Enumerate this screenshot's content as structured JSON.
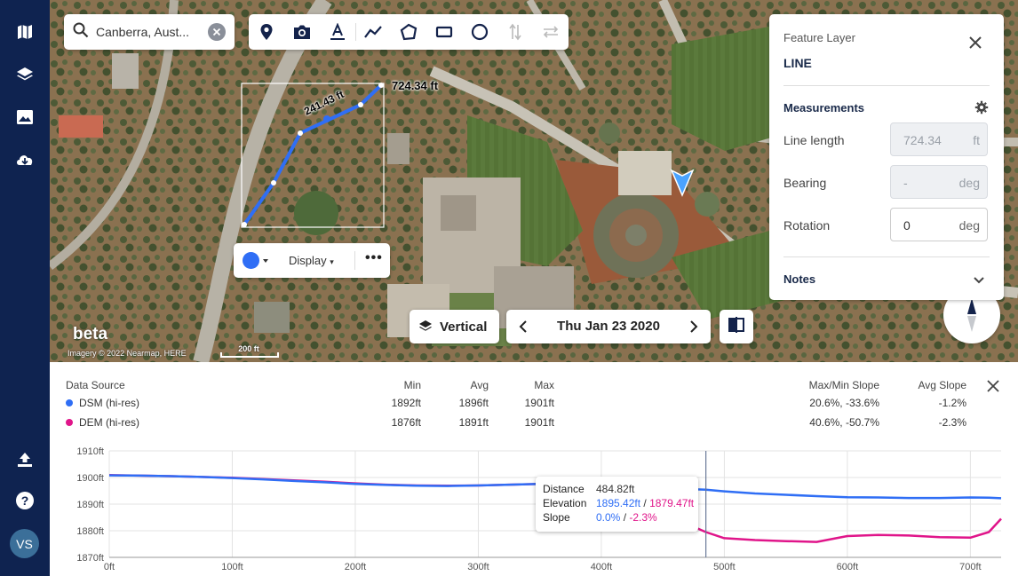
{
  "nav": {
    "items": [
      "map-icon",
      "layers-icon",
      "image-icon",
      "cloud-download-icon"
    ],
    "bottom": [
      "upload-icon",
      "help-icon"
    ],
    "avatar": "VS"
  },
  "search": {
    "value": "Canberra, Aust...",
    "placeholder": "Search"
  },
  "toolbar": {
    "tools": [
      "marker-icon",
      "camera-icon",
      "text-icon",
      "polyline-icon",
      "polygon-icon",
      "rectangle-icon",
      "circle-icon",
      "vertical-measure-icon",
      "swap-icon"
    ]
  },
  "map": {
    "segment_label": "241.43 ft",
    "total_label": "724.34 ft",
    "beta": "beta",
    "credit": "Imagery © 2022 Nearmap, HERE",
    "scale": "200 ft"
  },
  "style_bar": {
    "color": "#2f6ef5",
    "display_label": "Display",
    "more": "•••"
  },
  "view_mode": {
    "label": "Vertical"
  },
  "date_nav": {
    "date": "Thu Jan 23 2020"
  },
  "panel": {
    "subtitle": "Feature Layer",
    "title": "LINE",
    "measurements_title": "Measurements",
    "fields": [
      {
        "label": "Line length",
        "value": "724.34",
        "unit": "ft",
        "disabled": true
      },
      {
        "label": "Bearing",
        "value": "-",
        "unit": "deg",
        "disabled": true
      },
      {
        "label": "Rotation",
        "value": "0",
        "unit": "deg",
        "disabled": false
      }
    ],
    "notes_title": "Notes"
  },
  "profile": {
    "headers": {
      "source": "Data Source",
      "min": "Min",
      "avg": "Avg",
      "max": "Max",
      "slope": "Max/Min Slope",
      "avg_slope": "Avg Slope"
    },
    "rows": [
      {
        "name": "DSM (hi-res)",
        "color": "#2f6ef5",
        "min": "1892ft",
        "avg": "1896ft",
        "max": "1901ft",
        "slope": "20.6%, -33.6%",
        "avg_slope": "-1.2%"
      },
      {
        "name": "DEM (hi-res)",
        "color": "#e0158a",
        "min": "1876ft",
        "avg": "1891ft",
        "max": "1901ft",
        "slope": "40.6%, -50.7%",
        "avg_slope": "-2.3%"
      }
    ],
    "tooltip": {
      "distance_label": "Distance",
      "distance": "484.82ft",
      "elevation_label": "Elevation",
      "elev_dsm": "1895.42ft",
      "elev_sep": " / ",
      "elev_dem": "1879.47ft",
      "slope_label": "Slope",
      "slope_dsm": "0.0%",
      "slope_sep": " / ",
      "slope_dem": "-2.3%"
    }
  },
  "chart_data": {
    "type": "line",
    "x": [
      0,
      25,
      50,
      75,
      100,
      125,
      150,
      175,
      200,
      225,
      250,
      275,
      300,
      325,
      350,
      375,
      400,
      425,
      450,
      475,
      485,
      500,
      525,
      550,
      575,
      600,
      625,
      650,
      675,
      700,
      715,
      725
    ],
    "series": [
      {
        "name": "DSM (hi-res)",
        "color": "#2f6ef5",
        "values": [
          1900.8,
          1900.7,
          1900.5,
          1900.2,
          1899.8,
          1899.3,
          1898.7,
          1898.2,
          1897.6,
          1897.2,
          1896.9,
          1896.8,
          1897.0,
          1897.3,
          1897.6,
          1897.2,
          1896.7,
          1896.1,
          1895.8,
          1895.6,
          1895.4,
          1894.8,
          1894.0,
          1893.5,
          1893.0,
          1892.6,
          1892.5,
          1892.3,
          1892.3,
          1892.5,
          1892.4,
          1892.2
        ]
      },
      {
        "name": "DEM (hi-res)",
        "color": "#e0158a",
        "values": [
          1900.9,
          1900.7,
          1900.5,
          1900.2,
          1899.9,
          1899.4,
          1898.9,
          1898.4,
          1897.8,
          1897.3,
          1897.0,
          1896.9,
          1897.0,
          1897.3,
          1897.6,
          1896.4,
          1893.0,
          1889.0,
          1885.0,
          1881.5,
          1879.5,
          1877.2,
          1876.5,
          1876.1,
          1875.8,
          1878.0,
          1878.4,
          1878.2,
          1877.6,
          1877.4,
          1879.5,
          1884.5
        ]
      }
    ],
    "xlim": [
      0,
      725
    ],
    "ylim": [
      1870,
      1910
    ],
    "x_ticks": [
      "0ft",
      "100ft",
      "200ft",
      "300ft",
      "400ft",
      "500ft",
      "600ft",
      "700ft"
    ],
    "x_tick_values": [
      0,
      100,
      200,
      300,
      400,
      500,
      600,
      700
    ],
    "y_ticks": [
      "1910ft",
      "1900ft",
      "1890ft",
      "1880ft",
      "1870ft"
    ],
    "y_tick_values": [
      1910,
      1900,
      1890,
      1880,
      1870
    ],
    "cursor_x": 485,
    "grid": true
  }
}
